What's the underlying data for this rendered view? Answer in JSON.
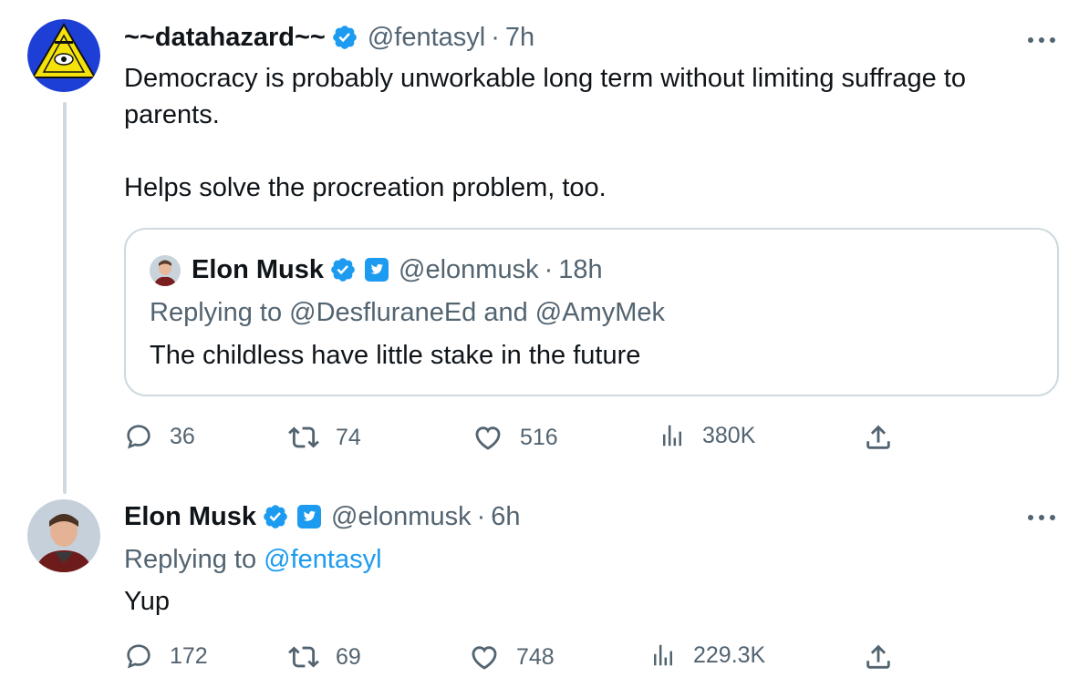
{
  "original_tweet": {
    "display_name": "~~datahazard~~",
    "handle": "@fentasyl",
    "separator": "·",
    "time": "7h",
    "text_lines": [
      "Democracy is probably unworkable long term without limiting suffrage to",
      "parents.",
      "Helps solve the procreation problem, too."
    ],
    "quoted": {
      "display_name": "Elon Musk",
      "handle": "@elonmusk",
      "separator": "·",
      "time": "18h",
      "replying_prefix": "Replying to ",
      "replying_users": "@DesfluraneEd and @AmyMek",
      "text": "The childless have little stake in the future"
    },
    "actions": {
      "replies": "36",
      "retweets": "74",
      "likes": "516",
      "views": "380K"
    }
  },
  "reply_tweet": {
    "display_name": "Elon Musk",
    "handle": "@elonmusk",
    "separator": "·",
    "time": "6h",
    "replying_prefix": "Replying to ",
    "replying_user": "@fentasyl",
    "text": "Yup",
    "actions": {
      "replies": "172",
      "retweets": "69",
      "likes": "748",
      "views": "229.3K"
    }
  },
  "colors": {
    "verified_blue": "#1d9bf0",
    "text_primary": "#0f1419",
    "text_secondary": "#536471",
    "border": "#cfd9de"
  },
  "icons": [
    "verified-badge-icon",
    "affiliate-badge-icon",
    "more-icon",
    "reply-icon",
    "retweet-icon",
    "like-icon",
    "views-icon",
    "share-icon"
  ]
}
